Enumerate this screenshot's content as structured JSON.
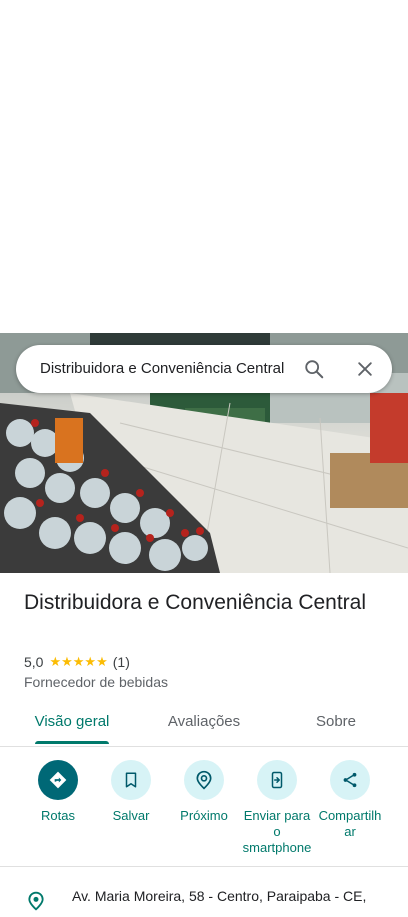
{
  "search": {
    "query": "Distribuidora e Conveniência Central"
  },
  "place": {
    "name": "Distribuidora e Conveniência Central",
    "rating": "5,0",
    "stars": "★★★★★",
    "review_count": "(1)",
    "category": "Fornecedor de bebidas",
    "address": "Av. Maria Moreira, 58 - Centro, Paraipaba - CE,"
  },
  "tabs": [
    {
      "label": "Visão geral",
      "active": true
    },
    {
      "label": "Avaliações",
      "active": false
    },
    {
      "label": "Sobre",
      "active": false
    }
  ],
  "actions": [
    {
      "label": "Rotas",
      "icon": "directions-icon"
    },
    {
      "label": "Salvar",
      "icon": "bookmark-icon"
    },
    {
      "label": "Próximo",
      "icon": "nearby-icon"
    },
    {
      "label": "Enviar para o smartphone",
      "icon": "send-to-phone-icon"
    },
    {
      "label": "Compartilhar",
      "icon": "share-icon"
    }
  ],
  "colors": {
    "accent": "#00796b",
    "primary_button": "#006876",
    "chip_bg": "#d7f3f6",
    "star": "#fbbc04"
  }
}
